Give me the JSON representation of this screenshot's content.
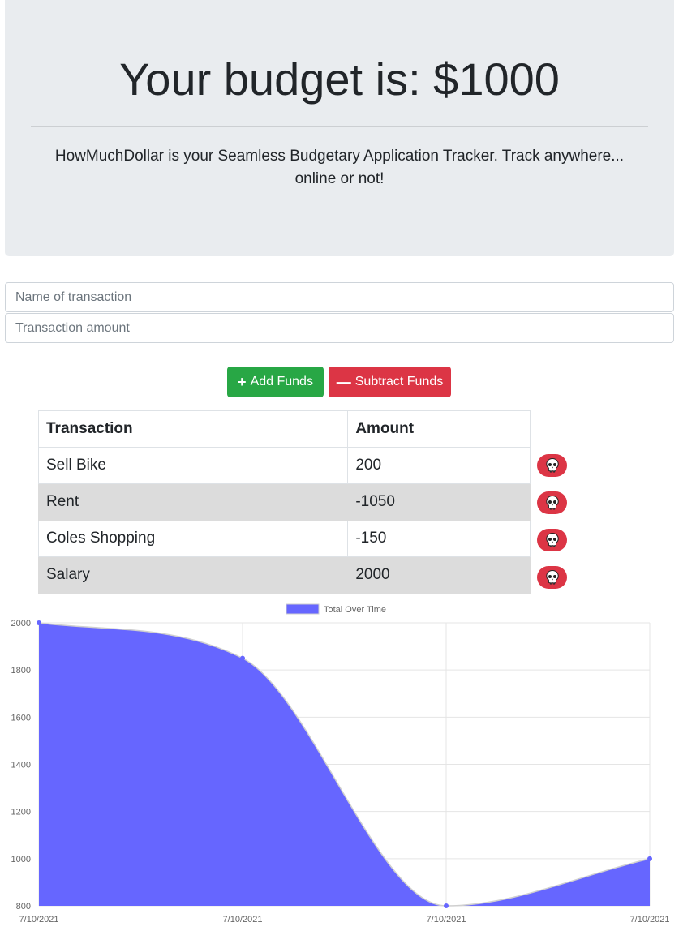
{
  "header": {
    "title": "Your budget is: $1000",
    "description": "HowMuchDollar is your Seamless Budgetary Application Tracker. Track anywhere... online or not!"
  },
  "form": {
    "name_placeholder": "Name of transaction",
    "amount_placeholder": "Transaction amount",
    "add_label": "Add Funds",
    "subtract_label": "Subtract Funds"
  },
  "table": {
    "headers": [
      "Transaction",
      "Amount"
    ],
    "rows": [
      {
        "name": "Sell Bike",
        "amount": "200"
      },
      {
        "name": "Rent",
        "amount": "-1050"
      },
      {
        "name": "Coles Shopping",
        "amount": "-150"
      },
      {
        "name": "Salary",
        "amount": "2000"
      }
    ],
    "delete_icon": "skull-icon"
  },
  "colors": {
    "add": "#28a745",
    "subtract": "#dc3545",
    "chart_fill": "#6666ff"
  },
  "chart_data": {
    "type": "area",
    "legend": "Total Over Time",
    "legend_position": "top",
    "x": [
      "7/10/2021",
      "7/10/2021",
      "7/10/2021",
      "7/10/2021"
    ],
    "values": [
      2000,
      1850,
      800,
      1000
    ],
    "yticks": [
      2000,
      1800,
      1600,
      1400,
      1200,
      1000,
      800
    ],
    "ylim": [
      800,
      2000
    ],
    "grid": true
  }
}
